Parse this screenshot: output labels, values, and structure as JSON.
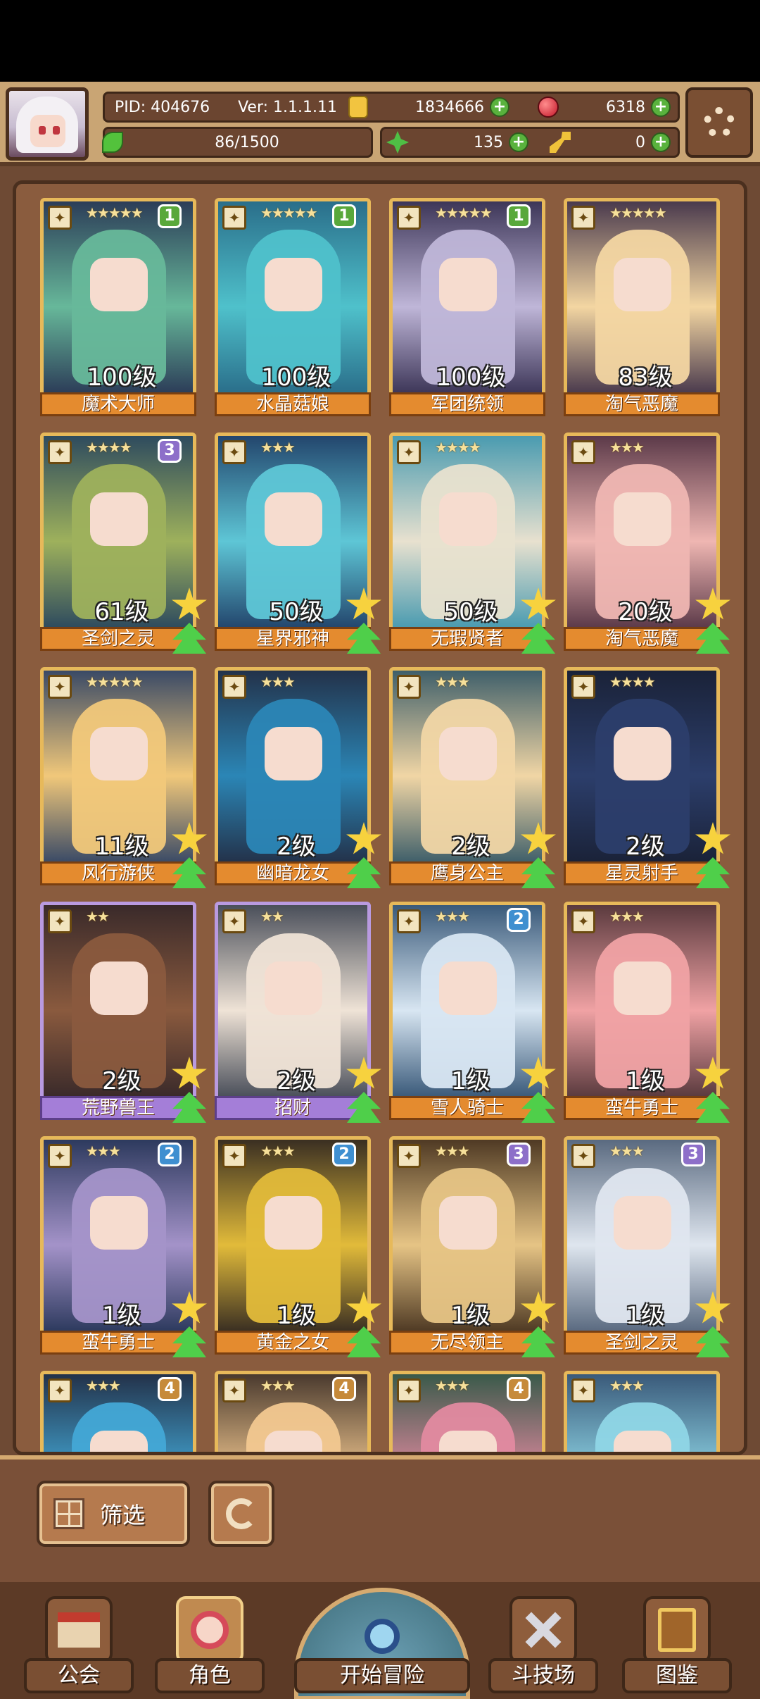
{
  "header": {
    "pid": "PID: 404676",
    "version": "Ver: 1.1.1.11",
    "gold": "1834666",
    "gems": "6318",
    "stamina": "86/1500",
    "clover": "135",
    "keys": "0"
  },
  "cards": [
    {
      "name": "魔术大师",
      "level": "100级",
      "stars": "★★★★★",
      "badge": "1",
      "badge_color": "#59a83b",
      "frame": "gold",
      "colors": [
        "#67b89a",
        "#2c3d58"
      ]
    },
    {
      "name": "水晶菇娘",
      "level": "100级",
      "stars": "★★★★★",
      "badge": "1",
      "badge_color": "#59a83b",
      "frame": "gold",
      "colors": [
        "#4fc1cb",
        "#2a6e8a"
      ]
    },
    {
      "name": "军团统领",
      "level": "100级",
      "stars": "★★★★★",
      "badge": "1",
      "badge_color": "#59a83b",
      "frame": "gold",
      "colors": [
        "#bfb6d8",
        "#3d3658"
      ]
    },
    {
      "name": "淘气恶魔",
      "level": "83级",
      "stars": "★★★★★",
      "badge": "",
      "badge_color": "",
      "frame": "gold",
      "colors": [
        "#f3d6a2",
        "#4a3a4d"
      ]
    },
    {
      "name": "圣剑之灵",
      "level": "61级",
      "stars": "★★★★",
      "badge": "3",
      "badge_color": "#8d6fc9",
      "frame": "gold",
      "colors": [
        "#9eb15c",
        "#2e4b5e"
      ]
    },
    {
      "name": "星界邪神",
      "level": "50级",
      "stars": "★★★",
      "badge": "",
      "badge_color": "",
      "frame": "gold",
      "colors": [
        "#5ec6d6",
        "#23466d"
      ]
    },
    {
      "name": "无瑕贤者",
      "level": "50级",
      "stars": "★★★★",
      "badge": "",
      "badge_color": "",
      "frame": "gold",
      "colors": [
        "#e8e1cf",
        "#4a9bb0"
      ]
    },
    {
      "name": "淘气恶魔",
      "level": "20级",
      "stars": "★★★",
      "badge": "",
      "badge_color": "",
      "frame": "gold",
      "colors": [
        "#efb6b2",
        "#5c3a49"
      ]
    },
    {
      "name": "风行游侠",
      "level": "11级",
      "stars": "★★★★★",
      "badge": "",
      "badge_color": "",
      "frame": "gold",
      "colors": [
        "#f1c87a",
        "#3a4a66"
      ]
    },
    {
      "name": "幽暗龙女",
      "level": "2级",
      "stars": "★★★",
      "badge": "",
      "badge_color": "",
      "frame": "gold",
      "colors": [
        "#2b86b6",
        "#23324a"
      ]
    },
    {
      "name": "鹰身公主",
      "level": "2级",
      "stars": "★★★",
      "badge": "",
      "badge_color": "",
      "frame": "gold",
      "colors": [
        "#f1d6a5",
        "#3f5f6a"
      ]
    },
    {
      "name": "星灵射手",
      "level": "2级",
      "stars": "★★★★",
      "badge": "",
      "badge_color": "",
      "frame": "gold",
      "colors": [
        "#2c3e6b",
        "#1a2238"
      ]
    },
    {
      "name": "荒野兽王",
      "level": "2级",
      "stars": "★★",
      "badge": "",
      "badge_color": "",
      "frame": "purple",
      "colors": [
        "#8a5a3e",
        "#3a2a2a"
      ]
    },
    {
      "name": "招财",
      "level": "2级",
      "stars": "★★",
      "badge": "",
      "badge_color": "",
      "frame": "purple",
      "colors": [
        "#efe3d6",
        "#4a4f5a"
      ]
    },
    {
      "name": "雪人骑士",
      "level": "1级",
      "stars": "★★★",
      "badge": "2",
      "badge_color": "#3f8fd0",
      "frame": "gold",
      "colors": [
        "#d8e6f2",
        "#3a5a7a"
      ]
    },
    {
      "name": "蛮牛勇士",
      "level": "1级",
      "stars": "★★★",
      "badge": "",
      "badge_color": "",
      "frame": "gold",
      "colors": [
        "#f0a2a4",
        "#5a3a3e"
      ]
    },
    {
      "name": "蛮牛勇士",
      "level": "1级",
      "stars": "★★★",
      "badge": "2",
      "badge_color": "#3f8fd0",
      "frame": "gold",
      "colors": [
        "#a493c9",
        "#2d3a5e"
      ]
    },
    {
      "name": "黄金之女",
      "level": "1级",
      "stars": "★★★",
      "badge": "2",
      "badge_color": "#3f8fd0",
      "frame": "gold",
      "colors": [
        "#e2bb3a",
        "#3a2f22"
      ]
    },
    {
      "name": "无尽领主",
      "level": "1级",
      "stars": "★★★",
      "badge": "3",
      "badge_color": "#8d6fc9",
      "frame": "gold",
      "colors": [
        "#e6c485",
        "#4f3a24"
      ]
    },
    {
      "name": "圣剑之灵",
      "level": "1级",
      "stars": "★★★",
      "badge": "3",
      "badge_color": "#8d6fc9",
      "frame": "gold",
      "colors": [
        "#dfe6ef",
        "#5a6a80"
      ]
    },
    {
      "name": "",
      "level": "",
      "stars": "★★★",
      "badge": "4",
      "badge_color": "#c68a3a",
      "frame": "gold",
      "colors": [
        "#43a8d6",
        "#23324a"
      ]
    },
    {
      "name": "",
      "level": "",
      "stars": "★★★",
      "badge": "4",
      "badge_color": "#c68a3a",
      "frame": "gold",
      "colors": [
        "#f2c890",
        "#4a3a2e"
      ]
    },
    {
      "name": "",
      "level": "",
      "stars": "★★★",
      "badge": "4",
      "badge_color": "#c68a3a",
      "frame": "gold",
      "colors": [
        "#e28aa0",
        "#3a5a4a"
      ]
    },
    {
      "name": "",
      "level": "",
      "stars": "★★★",
      "badge": "",
      "badge_color": "",
      "frame": "gold",
      "colors": [
        "#8fd6e6",
        "#3a5a7a"
      ]
    }
  ],
  "toolbar": {
    "filter_label": "筛选"
  },
  "nav": {
    "guild": "公会",
    "character": "角色",
    "adventure": "开始冒险",
    "arena": "斗技场",
    "codex": "图鉴"
  }
}
